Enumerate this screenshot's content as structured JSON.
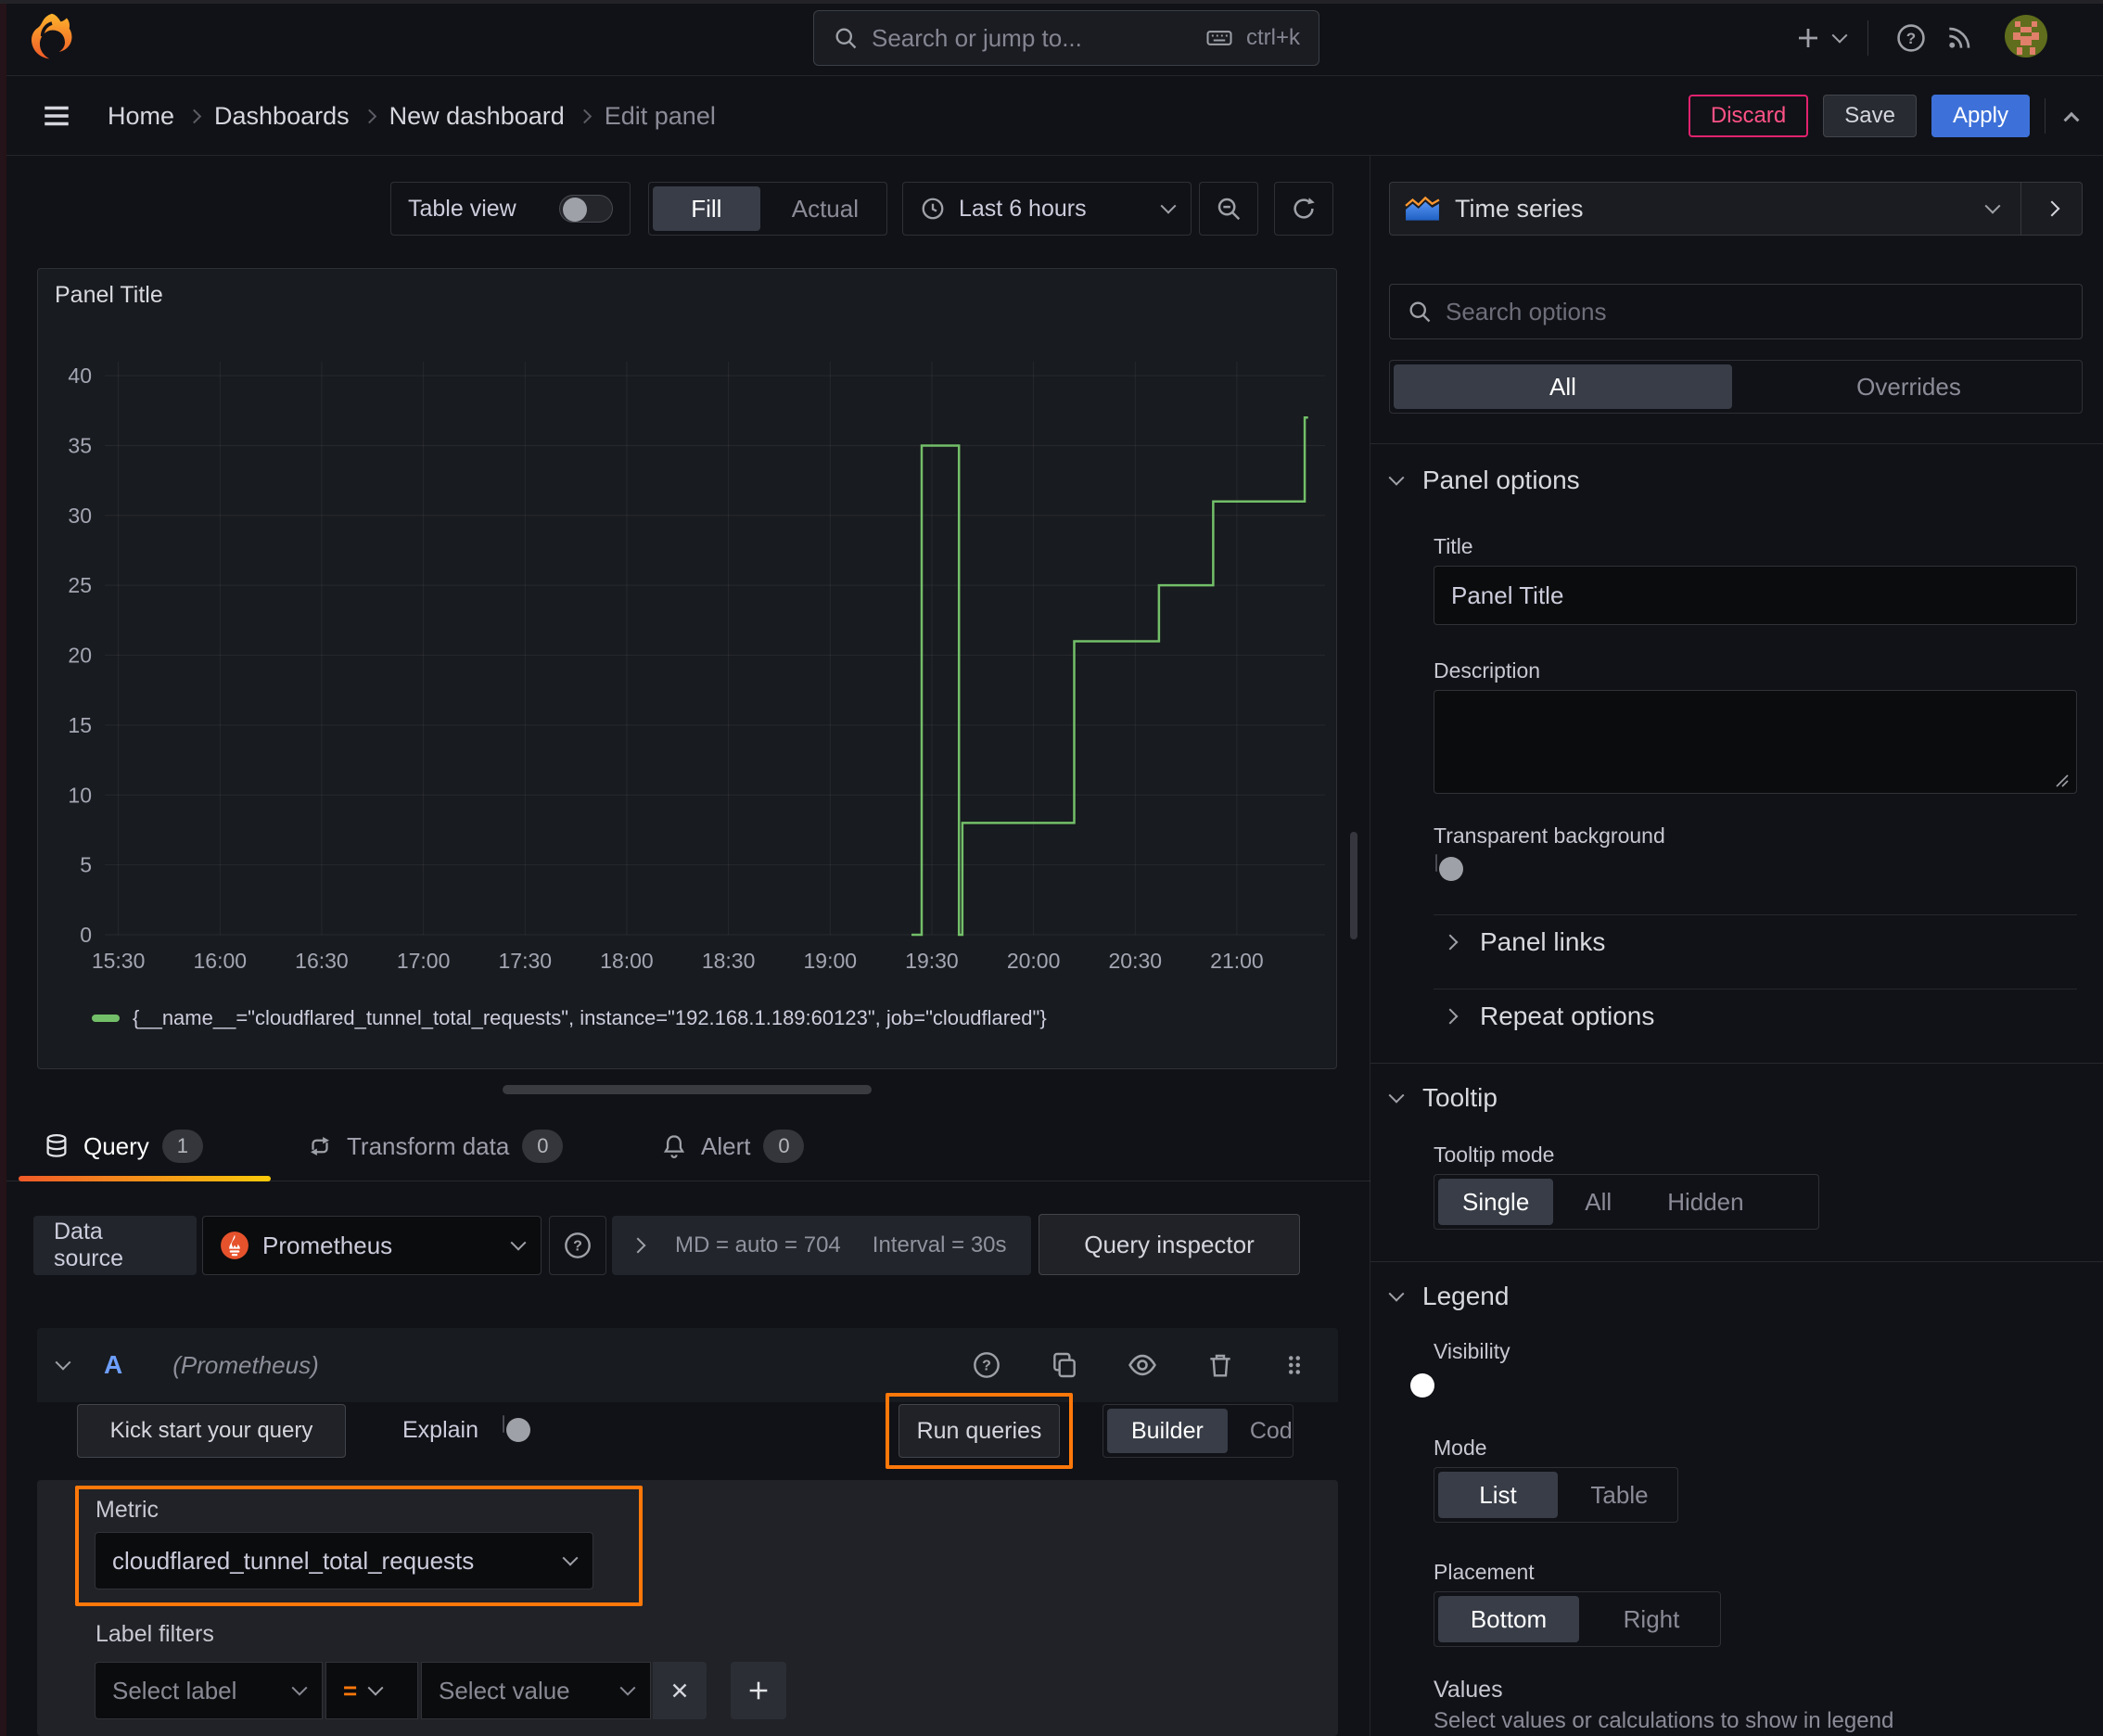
{
  "topbar": {
    "search_placeholder": "Search or jump to...",
    "search_shortcut": "ctrl+k"
  },
  "breadcrumb": {
    "items": [
      "Home",
      "Dashboards",
      "New dashboard",
      "Edit panel"
    ]
  },
  "actions": {
    "discard": "Discard",
    "save": "Save",
    "apply": "Apply"
  },
  "toolbar": {
    "table_view_label": "Table view",
    "fill_label": "Fill",
    "actual_label": "Actual",
    "time_range_label": "Last 6 hours"
  },
  "viz_picker": {
    "label": "Time series"
  },
  "panel": {
    "title": "Panel Title"
  },
  "chart_data": {
    "type": "line",
    "line_style": "step-after",
    "title": "Panel Title",
    "x_range": [
      "15:26",
      "21:26"
    ],
    "x_ticks": [
      "15:30",
      "16:00",
      "16:30",
      "17:00",
      "17:30",
      "18:00",
      "18:30",
      "19:00",
      "19:30",
      "20:00",
      "20:30",
      "21:00"
    ],
    "y_ticks": [
      0,
      5,
      10,
      15,
      20,
      25,
      30,
      35,
      40
    ],
    "ylim": [
      0,
      41
    ],
    "grid": true,
    "legend_position": "bottom",
    "series": [
      {
        "name": "{__name__=\"cloudflared_tunnel_total_requests\", instance=\"192.168.1.189:60123\", job=\"cloudflared\"}",
        "color": "#73bf69",
        "points": [
          [
            "19:24",
            0
          ],
          [
            "19:27",
            35
          ],
          [
            "19:38",
            0
          ],
          [
            "19:39",
            8
          ],
          [
            "20:12",
            21
          ],
          [
            "20:37",
            25
          ],
          [
            "20:53",
            31
          ],
          [
            "21:20",
            37
          ]
        ],
        "end_time": "21:21"
      }
    ]
  },
  "query_section": {
    "tabs": [
      {
        "label": "Query",
        "count": "1"
      },
      {
        "label": "Transform data",
        "count": "0"
      },
      {
        "label": "Alert",
        "count": "0"
      }
    ],
    "datasource_label": "Data source",
    "datasource_value": "Prometheus",
    "stats_md": "MD = auto = 704",
    "stats_interval": "Interval = 30s",
    "query_inspector_label": "Query inspector",
    "ref_id": "A",
    "ref_hint": "(Prometheus)",
    "kick_start_label": "Kick start your query",
    "explain_label": "Explain",
    "run_queries_label": "Run queries",
    "builder_label": "Builder",
    "code_label": "Code",
    "metric_label": "Metric",
    "metric_value": "cloudflared_tunnel_total_requests",
    "label_filters_label": "Label filters",
    "select_label_placeholder": "Select label",
    "operator_value": "=",
    "select_value_placeholder": "Select value"
  },
  "options_pane": {
    "search_placeholder": "Search options",
    "tab_all": "All",
    "tab_overrides": "Overrides",
    "panel_options_title": "Panel options",
    "title_label": "Title",
    "title_value": "Panel Title",
    "description_label": "Description",
    "transparent_label": "Transparent background",
    "panel_links_title": "Panel links",
    "repeat_options_title": "Repeat options",
    "tooltip_title": "Tooltip",
    "tooltip_mode_label": "Tooltip mode",
    "tooltip_modes": [
      "Single",
      "All",
      "Hidden"
    ],
    "tooltip_mode_selected": "Single",
    "legend_title": "Legend",
    "visibility_label": "Visibility",
    "mode_label": "Mode",
    "legend_modes": [
      "List",
      "Table"
    ],
    "legend_mode_selected": "List",
    "placement_label": "Placement",
    "placements": [
      "Bottom",
      "Right"
    ],
    "placement_selected": "Bottom",
    "values_label": "Values",
    "values_help": "Select values or calculations to show in legend"
  },
  "colors": {
    "background": "#111217",
    "panel_background": "#181b1f",
    "accent_orange": "#ff780a",
    "series_green": "#73bf69",
    "primary_blue": "#3d71d9",
    "destructive_pink": "#ff5286",
    "tab_underline_from": "#f05a28",
    "tab_underline_to": "#fbca0a",
    "prometheus_orange": "#e6522c"
  }
}
